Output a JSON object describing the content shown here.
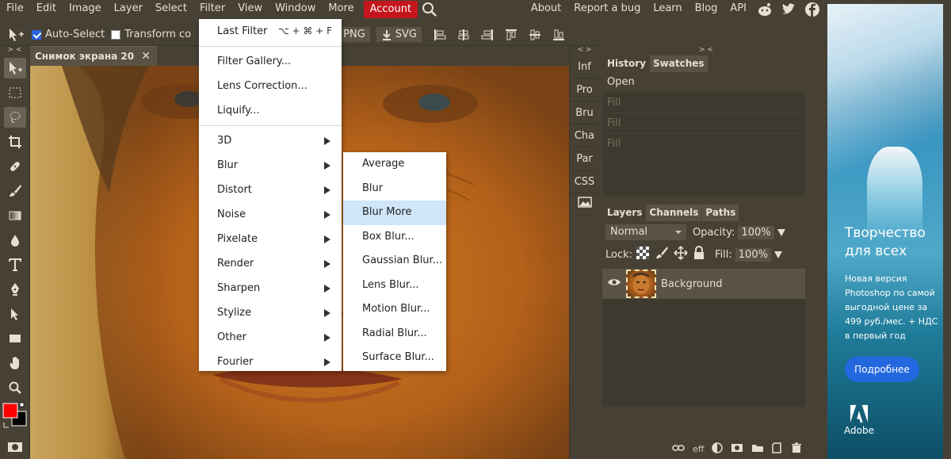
{
  "menubar": {
    "items": [
      "File",
      "Edit",
      "Image",
      "Layer",
      "Select",
      "Filter",
      "View",
      "Window",
      "More"
    ],
    "account": "Account",
    "right_items": [
      "About",
      "Report a bug",
      "Learn",
      "Blog",
      "API"
    ],
    "account_color": "#c4161c"
  },
  "options": {
    "auto_select": "Auto-Select",
    "transform": "Transform co",
    "png": "PNG",
    "svg": "SVG"
  },
  "toolbar": {
    "head": "> <",
    "foreground_color": "#ff0000",
    "background_color": "#000000"
  },
  "document": {
    "tab_title": "Снимок экрана 20",
    "close": "✕"
  },
  "filter_menu": {
    "last_filter": "Last Filter",
    "last_filter_shortcut": "⌥ + ⌘ + F",
    "group1": [
      "Filter Gallery...",
      "Lens Correction...",
      "Liquify..."
    ],
    "submenus": [
      "3D",
      "Blur",
      "Distort",
      "Noise",
      "Pixelate",
      "Render",
      "Sharpen",
      "Stylize",
      "Other",
      "Fourier"
    ]
  },
  "blur_menu": {
    "items": [
      "Average",
      "Blur",
      "Blur More",
      "Box Blur...",
      "Gaussian Blur...",
      "Lens Blur...",
      "Motion Blur...",
      "Radial Blur...",
      "Surface Blur..."
    ],
    "highlighted": "Blur More",
    "highlight_color": "#cfe5f8"
  },
  "mini_panel": {
    "head": "< >",
    "items": [
      "Inf",
      "Pro",
      "Bru",
      "Cha",
      "Par",
      "CSS"
    ]
  },
  "right_panel": {
    "head": "> <",
    "history_tabs": [
      "History",
      "Swatches"
    ],
    "history_items": [
      "Open",
      "Fill",
      "Fill",
      "Fill"
    ],
    "layer_tabs": [
      "Layers",
      "Channels",
      "Paths"
    ],
    "blend_mode": "Normal",
    "opacity_label": "Opacity:",
    "opacity_value": "100%",
    "lock_label": "Lock:",
    "fill_label": "Fill:",
    "fill_value": "100%",
    "layer_name": "Background",
    "footer_eff": "eff"
  },
  "ad": {
    "title_line1": "Творчество",
    "title_line2": "для всех",
    "body": "Новая версия Photoshop по самой выгодной цене за 499 руб./мес. + НДС в первый год",
    "button": "Подробнее",
    "brand": "Adobe"
  }
}
